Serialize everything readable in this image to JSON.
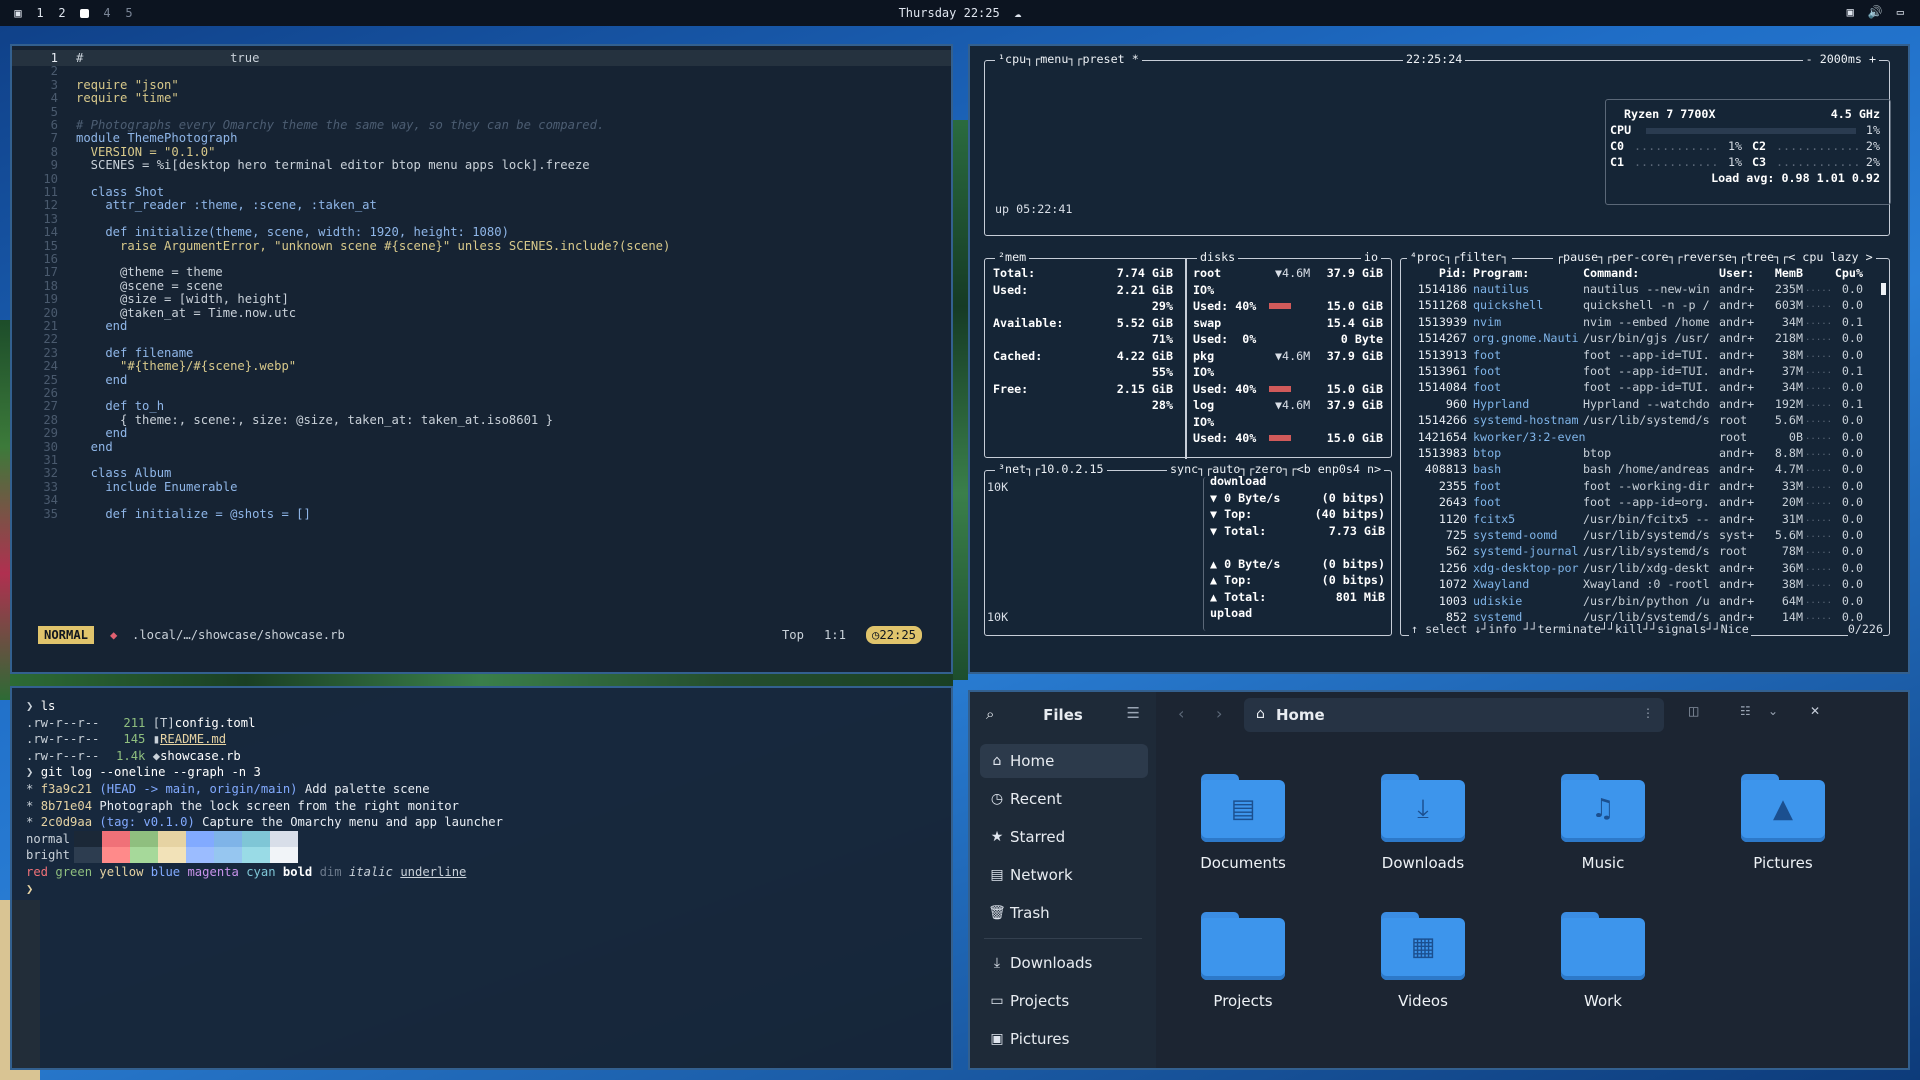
{
  "topbar": {
    "workspaces": [
      "1",
      "2",
      "3",
      "4",
      "5"
    ],
    "active_workspace": "3",
    "clock": "Thursday 22:25",
    "icons": [
      "window-icon",
      "volume-icon",
      "notification-icon"
    ]
  },
  "editor": {
    "lines": [
      {
        "n": "1",
        "t": "#                    true"
      },
      {
        "n": "2",
        "t": ""
      },
      {
        "n": "3",
        "t": "require \"json\""
      },
      {
        "n": "4",
        "t": "require \"time\""
      },
      {
        "n": "5",
        "t": ""
      },
      {
        "n": "6",
        "t": "# Photographs every Omarchy theme the same way, so they can be compared."
      },
      {
        "n": "7",
        "t": "module ThemePhotograph"
      },
      {
        "n": "8",
        "t": "  VERSION = \"0.1.0\""
      },
      {
        "n": "9",
        "t": "  SCENES = %i[desktop hero terminal editor btop menu apps lock].freeze"
      },
      {
        "n": "10",
        "t": ""
      },
      {
        "n": "11",
        "t": "  class Shot"
      },
      {
        "n": "12",
        "t": "    attr_reader :theme, :scene, :taken_at"
      },
      {
        "n": "13",
        "t": ""
      },
      {
        "n": "14",
        "t": "    def initialize(theme, scene, width: 1920, height: 1080)"
      },
      {
        "n": "15",
        "t": "      raise ArgumentError, \"unknown scene #{scene}\" unless SCENES.include?(scene)"
      },
      {
        "n": "16",
        "t": ""
      },
      {
        "n": "17",
        "t": "      @theme = theme"
      },
      {
        "n": "18",
        "t": "      @scene = scene"
      },
      {
        "n": "19",
        "t": "      @size = [width, height]"
      },
      {
        "n": "20",
        "t": "      @taken_at = Time.now.utc"
      },
      {
        "n": "21",
        "t": "    end"
      },
      {
        "n": "22",
        "t": ""
      },
      {
        "n": "23",
        "t": "    def filename"
      },
      {
        "n": "24",
        "t": "      \"#{theme}/#{scene}.webp\""
      },
      {
        "n": "25",
        "t": "    end"
      },
      {
        "n": "26",
        "t": ""
      },
      {
        "n": "27",
        "t": "    def to_h"
      },
      {
        "n": "28",
        "t": "      { theme:, scene:, size: @size, taken_at: taken_at.iso8601 }"
      },
      {
        "n": "29",
        "t": "    end"
      },
      {
        "n": "30",
        "t": "  end"
      },
      {
        "n": "31",
        "t": ""
      },
      {
        "n": "32",
        "t": "  class Album"
      },
      {
        "n": "33",
        "t": "    include Enumerable"
      },
      {
        "n": "34",
        "t": ""
      },
      {
        "n": "35",
        "t": "    def initialize = @shots = []"
      }
    ],
    "status": {
      "mode": "NORMAL",
      "path": ".local/…/showcase/showcase.rb",
      "pos_label": "Top",
      "cursor": "1:1",
      "time": "22:25"
    }
  },
  "btop": {
    "cpu_box": {
      "title": "¹cpu┐┌menu┐┌preset *",
      "time": "22:25:24",
      "refresh": "- 2000ms +",
      "model": "Ryzen 7 7700X",
      "freq": "4.5 GHz",
      "rows": [
        {
          "l": "CPU",
          "v": "1%"
        },
        {
          "l": "C0",
          "v": "1%",
          "l2": "C2",
          "v2": "2%"
        },
        {
          "l": "C1",
          "v": "1%",
          "l2": "C3",
          "v2": "2%"
        }
      ],
      "load": "Load avg: 0.98 1.01 0.92",
      "uptime": "up 05:22:41"
    },
    "mem_box": {
      "title": "²mem",
      "rows": [
        {
          "l": "Total:",
          "v": "7.74 GiB"
        },
        {
          "l": "Used:",
          "v": "2.21 GiB"
        },
        {
          "l": "",
          "v": "29%"
        },
        {
          "l": "Available:",
          "v": "5.52 GiB"
        },
        {
          "l": "",
          "v": "71%"
        },
        {
          "l": "Cached:",
          "v": "4.22 GiB"
        },
        {
          "l": "",
          "v": "55%"
        },
        {
          "l": "Free:",
          "v": "2.15 GiB"
        },
        {
          "l": "",
          "v": "28%"
        }
      ]
    },
    "disks_box": {
      "title": "disks",
      "io": "io",
      "rows": [
        {
          "a": "root",
          "b": "▼4.6M",
          "c": "37.9 GiB"
        },
        {
          "a": "IO%",
          "b": "",
          "c": ""
        },
        {
          "a": "Used: 40%",
          "b": "bar",
          "c": "15.0 GiB"
        },
        {
          "a": "swap",
          "b": "",
          "c": "15.4 GiB"
        },
        {
          "a": "Used:  0%",
          "b": "",
          "c": "0 Byte"
        },
        {
          "a": "pkg",
          "b": "▼4.6M",
          "c": "37.9 GiB"
        },
        {
          "a": "IO%",
          "b": "",
          "c": ""
        },
        {
          "a": "Used: 40%",
          "b": "bar",
          "c": "15.0 GiB"
        },
        {
          "a": "log",
          "b": "▼4.6M",
          "c": "37.9 GiB"
        },
        {
          "a": "IO%",
          "b": "",
          "c": ""
        },
        {
          "a": "Used: 40%",
          "b": "bar",
          "c": "15.0 GiB"
        }
      ]
    },
    "net_box": {
      "title": "³net┐┌10.0.2.15",
      "tabs": "sync┐┌auto┐┌zero┐┌<b enp0s4 n>",
      "scale_top": "10K",
      "scale_bottom": "10K",
      "rows": [
        {
          "l": "download",
          "v": ""
        },
        {
          "l": "▼ 0 Byte/s",
          "v": "(0 bitps)"
        },
        {
          "l": "▼ Top:",
          "v": "(40 bitps)"
        },
        {
          "l": "▼ Total:",
          "v": "7.73 GiB"
        },
        {
          "l": "",
          "v": ""
        },
        {
          "l": "▲ 0 Byte/s",
          "v": "(0 bitps)"
        },
        {
          "l": "▲ Top:",
          "v": "(0 bitps)"
        },
        {
          "l": "▲ Total:",
          "v": "801 MiB"
        },
        {
          "l": "upload",
          "v": ""
        }
      ]
    },
    "proc_box": {
      "title": "⁴proc┐┌filter┐",
      "opts": "┌pause┐┌per-core┐┌reverse┐┌tree┐┌< cpu lazy >",
      "headers": [
        "Pid:",
        "Program:",
        "Command:",
        "User:",
        "MemB",
        "Cpu%"
      ],
      "rows": [
        [
          "1514186",
          "nautilus",
          "nautilus --new-win",
          "andr+",
          "235M",
          "0.0"
        ],
        [
          "1511268",
          "quickshell",
          "quickshell -n -p /",
          "andr+",
          "603M",
          "0.0"
        ],
        [
          "1513939",
          "nvim",
          "nvim --embed /home",
          "andr+",
          "34M",
          "0.1"
        ],
        [
          "1514267",
          "org.gnome.Nauti",
          "/usr/bin/gjs /usr/",
          "andr+",
          "218M",
          "0.0"
        ],
        [
          "1513913",
          "foot",
          "foot --app-id=TUI.",
          "andr+",
          "38M",
          "0.0"
        ],
        [
          "1513961",
          "foot",
          "foot --app-id=TUI.",
          "andr+",
          "37M",
          "0.1"
        ],
        [
          "1514084",
          "foot",
          "foot --app-id=TUI.",
          "andr+",
          "34M",
          "0.0"
        ],
        [
          "960",
          "Hyprland",
          "Hyprland --watchdo",
          "andr+",
          "192M",
          "0.1"
        ],
        [
          "1514266",
          "systemd-hostnam",
          "/usr/lib/systemd/s",
          "root",
          "5.6M",
          "0.0"
        ],
        [
          "1421654",
          "kworker/3:2-even",
          "",
          "root",
          "0B",
          "0.0"
        ],
        [
          "1513983",
          "btop",
          "btop",
          "andr+",
          "8.8M",
          "0.0"
        ],
        [
          "408813",
          "bash",
          "bash /home/andreas",
          "andr+",
          "4.7M",
          "0.0"
        ],
        [
          "2355",
          "foot",
          "foot --working-dir",
          "andr+",
          "33M",
          "0.0"
        ],
        [
          "2643",
          "foot",
          "foot --app-id=org.",
          "andr+",
          "20M",
          "0.0"
        ],
        [
          "1120",
          "fcitx5",
          "/usr/bin/fcitx5 --",
          "andr+",
          "31M",
          "0.0"
        ],
        [
          "725",
          "systemd-oomd",
          "/usr/lib/systemd/s",
          "syst+",
          "5.6M",
          "0.0"
        ],
        [
          "562",
          "systemd-journal",
          "/usr/lib/systemd/s",
          "root",
          "78M",
          "0.0"
        ],
        [
          "1256",
          "xdg-desktop-por",
          "/usr/lib/xdg-deskt",
          "andr+",
          "36M",
          "0.0"
        ],
        [
          "1072",
          "Xwayland",
          "Xwayland :0 -rootl",
          "andr+",
          "38M",
          "0.0"
        ],
        [
          "1003",
          "udiskie",
          "/usr/bin/python /u",
          "andr+",
          "64M",
          "0.0"
        ],
        [
          "852",
          "systemd",
          "/usr/lib/systemd/s",
          "andr+",
          "14M",
          "0.0"
        ]
      ],
      "footer": "↑ select ↓┘info ┘┘terminate┘┘kill┘┘signals┘┘Nice",
      "count": "0/226"
    }
  },
  "terminal": {
    "prompt": "❯",
    "cmd1": "ls",
    "ls": [
      {
        "perm": ".rw-r--r--",
        "size": "211",
        "icon": "[T]",
        "name": "config.toml"
      },
      {
        "perm": ".rw-r--r--",
        "size": "145",
        "icon": "▮",
        "name": "README.md"
      },
      {
        "perm": ".rw-r--r--",
        "size": "1.4k",
        "icon": "◆",
        "name": "showcase.rb"
      }
    ],
    "cmd2": "git log --oneline --graph -n 3",
    "log": [
      {
        "hash": "f3a9c21",
        "ref": "(HEAD -> main, origin/main)",
        "msg": "Add palette scene"
      },
      {
        "hash": "8b71e04",
        "ref": "",
        "msg": "Photograph the lock screen from the right monitor"
      },
      {
        "hash": "2c0d9aa",
        "ref": "(tag: v0.1.0)",
        "msg": "Capture the Omarchy menu and app launcher"
      }
    ],
    "palette_labels": [
      "normal",
      "bright"
    ],
    "normal_colors": [
      "#1b2837",
      "#f07178",
      "#8fbf7f",
      "#e6d3a3",
      "#82aaff",
      "#7fb4e8",
      "#7fc6d6",
      "#d8dee9"
    ],
    "bright_colors": [
      "#2d3d50",
      "#ff8a8a",
      "#a6d99a",
      "#f2e2b8",
      "#9bbcff",
      "#96c6f0",
      "#99dbe6",
      "#f1f4f8"
    ],
    "styles": [
      "red",
      "green",
      "yellow",
      "blue",
      "magenta",
      "cyan",
      "bold",
      "dim",
      "italic",
      "underline"
    ],
    "style_colors": [
      "#f07178",
      "#8fbf7f",
      "#e6d3a3",
      "#82aaff",
      "#c792ea",
      "#7fc6d6",
      "#ffffff",
      "#6c7a8c",
      "#c9d1d9",
      "#c9d1d9"
    ]
  },
  "files": {
    "title": "Files",
    "location": "Home",
    "sidebar": [
      "Home",
      "Recent",
      "Starred",
      "Network",
      "Trash",
      "Downloads",
      "Projects",
      "Pictures"
    ],
    "sidebar_icons": [
      "home-icon",
      "clock-icon",
      "star-icon",
      "network-icon",
      "trash-icon",
      "download-icon",
      "folder-icon",
      "image-icon"
    ],
    "folders": [
      {
        "name": "Documents",
        "icon": "document-icon"
      },
      {
        "name": "Downloads",
        "icon": "download-icon"
      },
      {
        "name": "Music",
        "icon": "music-icon"
      },
      {
        "name": "Pictures",
        "icon": "image-icon"
      },
      {
        "name": "Projects",
        "icon": "folder-icon"
      },
      {
        "name": "Videos",
        "icon": "film-icon"
      },
      {
        "name": "Work",
        "icon": "folder-icon"
      }
    ]
  }
}
